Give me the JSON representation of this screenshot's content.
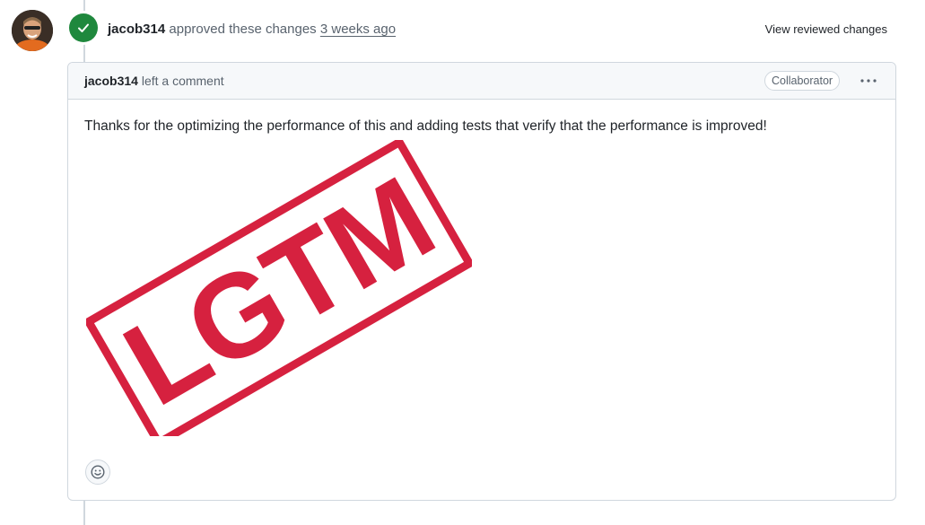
{
  "review": {
    "author": "jacob314",
    "action": "approved these changes",
    "time": "3 weeks ago",
    "view_label": "View reviewed changes"
  },
  "comment": {
    "author": "jacob314",
    "action": "left a comment",
    "role": "Collaborator",
    "body": "Thanks for the optimizing the performance of this and adding tests that verify that the performance is improved!",
    "image": {
      "stamp_text": "LGTM",
      "stamp_color": "#d6213f"
    }
  },
  "icons": {
    "check": "check-icon",
    "kebab": "kebab-horizontal-icon",
    "reaction": "smiley-icon"
  },
  "colors": {
    "approved": "#1f883d",
    "border": "#d0d7de",
    "header_bg": "#f6f8fa"
  }
}
